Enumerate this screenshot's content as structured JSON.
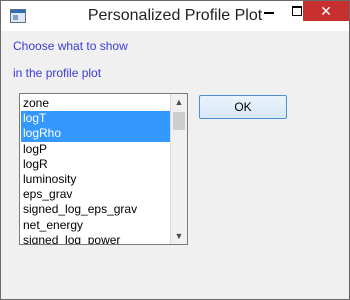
{
  "window": {
    "title": "Personalized Profile Plot",
    "controls": {
      "minimize_icon": "minimize-icon",
      "maximize_icon": "maximize-icon",
      "close_glyph": "✕"
    }
  },
  "prompt": {
    "line1": "Choose what to show",
    "line2": "in the profile plot",
    "color": "#3b3bd6"
  },
  "listbox": {
    "items": [
      {
        "label": "zone",
        "selected": false
      },
      {
        "label": "logT",
        "selected": true
      },
      {
        "label": "logRho",
        "selected": true
      },
      {
        "label": "logP",
        "selected": false
      },
      {
        "label": "logR",
        "selected": false
      },
      {
        "label": "luminosity",
        "selected": false
      },
      {
        "label": "eps_grav",
        "selected": false
      },
      {
        "label": "signed_log_eps_grav",
        "selected": false
      },
      {
        "label": "net_energy",
        "selected": false
      },
      {
        "label": "signed_log_power",
        "selected": false
      }
    ],
    "selection_color": "#3399ff"
  },
  "buttons": {
    "ok_label": "OK"
  }
}
